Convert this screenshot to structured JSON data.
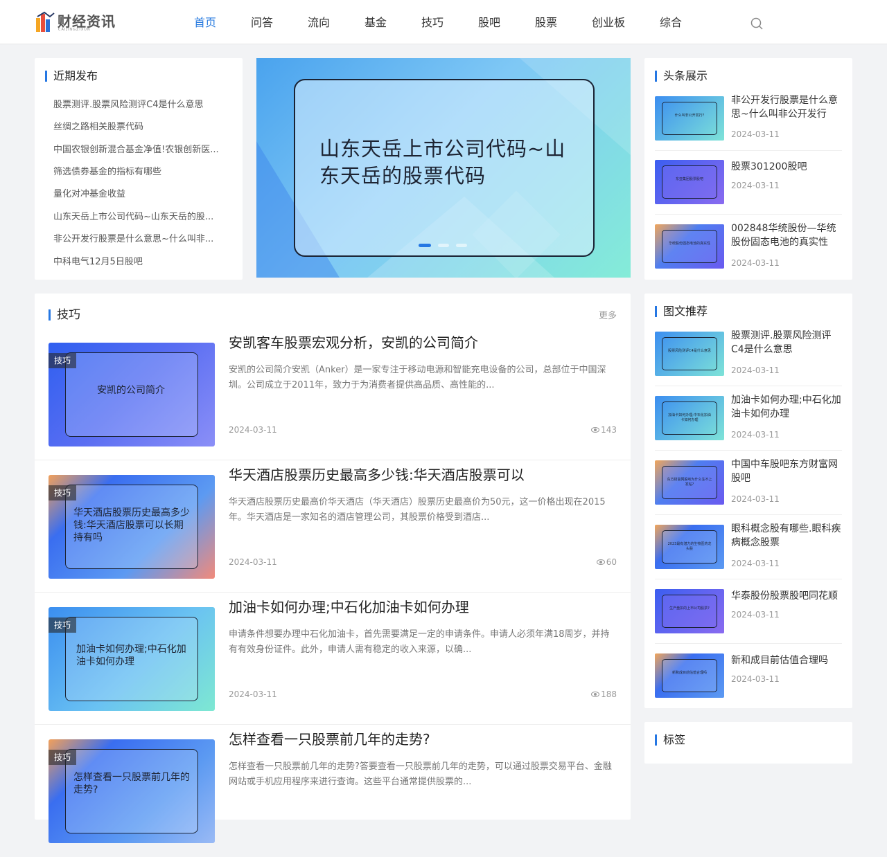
{
  "site": {
    "logo_text": "财经资讯",
    "logo_sub": "CAIJINGZIXUN"
  },
  "nav": {
    "items": [
      "首页",
      "问答",
      "流向",
      "基金",
      "技巧",
      "股吧",
      "股票",
      "创业板",
      "综合"
    ],
    "active_index": 0
  },
  "recent": {
    "title": "近期发布",
    "items": [
      "股票测评.股票风险测评C4是什么意思",
      "丝绸之路相关股票代码",
      "中国农银创新混合基金净值!农银创新医...",
      "筛选债券基金的指标有哪些",
      "量化对冲基金收益",
      "山东天岳上市公司代码~山东天岳的股...",
      "非公开发行股票是什么意思~什么叫非...",
      "中科电气12月5日股吧"
    ]
  },
  "banner": {
    "title": "山东天岳上市公司代码~山东天岳的股票代码",
    "slide_count": 3,
    "active_slide": 0
  },
  "headlines": {
    "title": "头条展示",
    "items": [
      {
        "title": "非公开发行股票是什么意思~什么叫非公开发行",
        "date": "2024-03-11",
        "thumb": "什么叫非公开发行?"
      },
      {
        "title": "股票301200股吧",
        "date": "2024-03-11",
        "thumb": "东亚集团股票股吧"
      },
      {
        "title": "002848华统股份—华统股份固态电池的真实性",
        "date": "2024-03-11",
        "thumb": "华统股份固态电池的真实性"
      }
    ]
  },
  "skills": {
    "title": "技巧",
    "more": "更多",
    "articles": [
      {
        "tag": "技巧",
        "thumb_text": "安凯的公司简介",
        "title": "安凯客车股票宏观分析，安凯的公司简介",
        "desc": "安凯的公司简介安凯（Anker）是一家专注于移动电源和智能充电设备的公司，总部位于中国深圳。公司成立于2011年，致力于为消费者提供高品质、高性能的...",
        "date": "2024-03-11",
        "views": "143"
      },
      {
        "tag": "技巧",
        "thumb_text": "华天酒店股票历史最高多少钱:华天酒店股票可以长期持有吗",
        "title": "华天酒店股票历史最高多少钱:华天酒店股票可以",
        "desc": "华天酒店股票历史最高价华天酒店（华天酒店）股票历史最高价为50元，这一价格出现在2015年。华天酒店是一家知名的酒店管理公司，其股票价格受到酒店...",
        "date": "2024-03-11",
        "views": "60"
      },
      {
        "tag": "技巧",
        "thumb_text": "加油卡如何办理;中石化加油卡如何办理",
        "title": "加油卡如何办理;中石化加油卡如何办理",
        "desc": "申请条件想要办理中石化加油卡，首先需要满足一定的申请条件。申请人必须年满18周岁，并持有有效身份证件。此外，申请人需有稳定的收入来源，以确...",
        "date": "2024-03-11",
        "views": "188"
      },
      {
        "tag": "技巧",
        "thumb_text": "怎样查看一只股票前几年的走势?",
        "title": "怎样查看一只股票前几年的走势?",
        "desc": "怎样查看一只股票前几年的走势?答要查看一只股票前几年的走势，可以通过股票交易平台、金融网站或手机应用程序来进行查询。这些平台通常提供股票的...",
        "date": "",
        "views": ""
      }
    ]
  },
  "picks": {
    "title": "图文推荐",
    "items": [
      {
        "title": "股票测评.股票风险测评C4是什么意思",
        "date": "2024-03-11",
        "thumb": "股票风险测评C4是什么意思"
      },
      {
        "title": "加油卡如何办理;中石化加油卡如何办理",
        "date": "2024-03-11",
        "thumb": "加油卡如何办理;中石化加油卡如何办理"
      },
      {
        "title": "中国中车股吧东方财富网股吧",
        "date": "2024-03-11",
        "thumb": "东方财富网股吧为什么注不上发帖?"
      },
      {
        "title": "眼科概念股有哪些.眼科疾病概念股票",
        "date": "2024-03-11",
        "thumb": "2023最有潜力的生物医药龙头股"
      },
      {
        "title": "华泰股份股票股吧同花顺",
        "date": "2024-03-11",
        "thumb": "生产盘扣的上市公司股票?"
      },
      {
        "title": "新和成目前估值合理吗",
        "date": "2024-03-11",
        "thumb": "新和成目前估值合理吗"
      }
    ]
  },
  "tags": {
    "title": "标签"
  },
  "colors": {
    "accent": "#2d7ee0",
    "bar": "#2577e3"
  }
}
